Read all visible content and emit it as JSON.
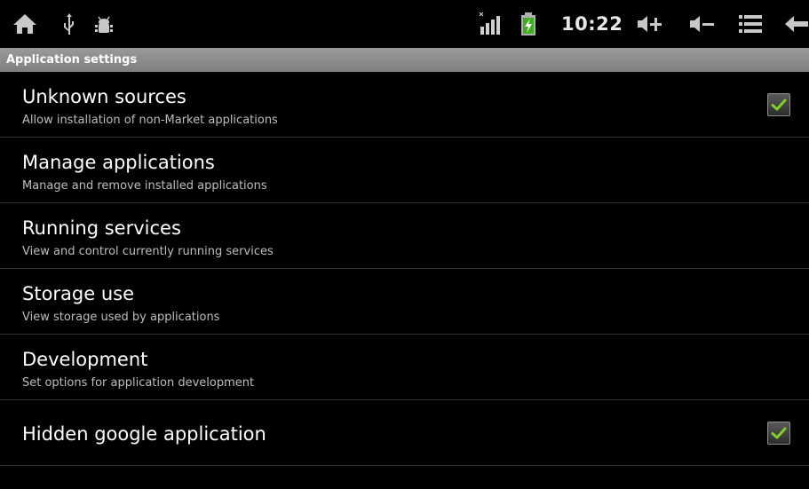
{
  "status_bar": {
    "time": "10:22",
    "left_icons": [
      "home-icon",
      "usb-icon",
      "android-debug-icon"
    ],
    "right_icons": [
      "signal-icon",
      "battery-charging-icon",
      "volume-up-icon",
      "volume-down-icon",
      "menu-icon",
      "back-icon"
    ]
  },
  "section_header": "Application settings",
  "items": [
    {
      "title": "Unknown sources",
      "summary": "Allow installation of non-Market applications",
      "checked": true
    },
    {
      "title": "Manage applications",
      "summary": "Manage and remove installed applications"
    },
    {
      "title": "Running services",
      "summary": "View and control currently running services"
    },
    {
      "title": "Storage use",
      "summary": "View storage used by applications"
    },
    {
      "title": "Development",
      "summary": "Set options for application development"
    },
    {
      "title": "Hidden google application",
      "checked": true
    }
  ],
  "colors": {
    "checkmark": "#7dd320",
    "header_bg": "#8a8a8a",
    "background": "#000000"
  }
}
